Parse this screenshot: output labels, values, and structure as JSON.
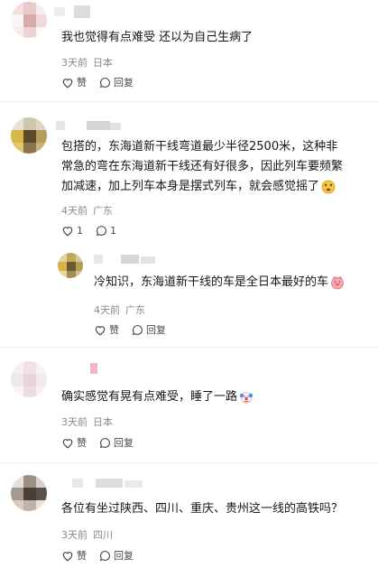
{
  "comments": [
    {
      "text_lines": [
        "我也觉得有点难受 还以为自己生病了"
      ],
      "time": "3天前",
      "location": "日本",
      "like_label": "赞",
      "reply_label": "回复"
    },
    {
      "text_lines": [
        "包搭的，东海道新干线弯道最少半径2500米，这种非",
        "常急的弯在东海道新干线还有好很多，因此列车要频繁",
        "加减速，加上列车本身是摆式列车，就会感觉摇了"
      ],
      "time": "4天前",
      "location": "广东",
      "like_count": "1",
      "reply_count": "1"
    },
    {
      "text_lines": [
        "冷知识，东海道新干线的车是全日本最好的车"
      ],
      "time": "4天前",
      "location": "广东",
      "like_label": "赞",
      "reply_label": "回复"
    },
    {
      "text_lines": [
        "确实感觉有晃有点难受，睡了一路"
      ],
      "time": "3天前",
      "location": "日本",
      "like_label": "赞",
      "reply_label": "回复"
    },
    {
      "text_lines": [
        "各位有坐过陕西、四川、重庆、贵州这一线的高铁吗？"
      ],
      "time": "3天前",
      "location": "四川",
      "like_label": "赞",
      "reply_label": "回复"
    }
  ],
  "icons": {
    "like": "heart-outline-icon",
    "reply": "speech-bubble-icon",
    "emoji_dizzy": "dizzy-face-emoji-icon",
    "emoji_pig": "pig-face-emoji-icon",
    "emoji_clown": "clown-face-emoji-icon"
  },
  "colors": {
    "text": "#161616",
    "meta": "#8a8a8a",
    "action": "#4a4a4a",
    "divider": "#ededed"
  }
}
